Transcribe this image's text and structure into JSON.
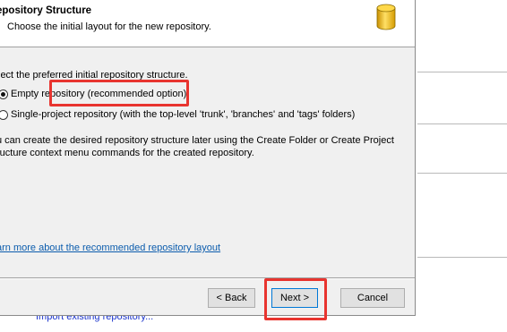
{
  "dialog": {
    "banner": {
      "title": "epository Structure",
      "subtitle": "Choose the initial layout for the new repository.",
      "icon": "database-cylinder-icon"
    },
    "prompt": "lect the preferred initial repository structure.",
    "options": [
      {
        "label": "Empty repository (recommended option)",
        "selected": true
      },
      {
        "label": "Single-project repository (with the top-level 'trunk', 'branches' and 'tags' folders)",
        "selected": false
      }
    ],
    "info_line1": "u can create the desired repository structure later using the Create Folder or Create Project",
    "info_line2": "ructure context menu commands for the created repository.",
    "learn_link": "arn more about the recommended repository layout",
    "buttons": {
      "back": "< Back",
      "next": "Next >",
      "cancel": "Cancel"
    }
  },
  "background": {
    "link": "Import existing repository..."
  },
  "colors": {
    "highlight": "#e8342f",
    "link": "#0b5cad",
    "dialog_bg": "#f0f0f0"
  }
}
